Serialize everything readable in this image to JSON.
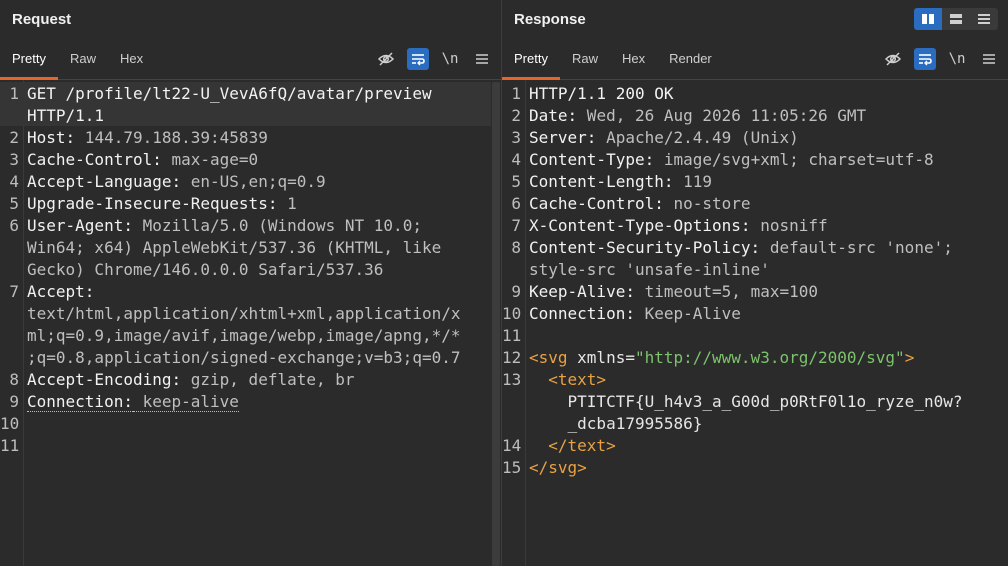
{
  "request": {
    "title": "Request",
    "tabs": [
      "Pretty",
      "Raw",
      "Hex"
    ],
    "active_tab": "Pretty",
    "lines": [
      {
        "n": "1",
        "key": "GET /profile/lt22-U_VevA6fQ/avatar/preview",
        "val": ""
      },
      {
        "n": "",
        "key": "HTTP/1.1",
        "val": ""
      },
      {
        "n": "2",
        "key": "Host:",
        "val": " 144.79.188.39:45839"
      },
      {
        "n": "3",
        "key": "Cache-Control:",
        "val": " max-age=0"
      },
      {
        "n": "4",
        "key": "Accept-Language:",
        "val": " en-US,en;q=0.9"
      },
      {
        "n": "5",
        "key": "Upgrade-Insecure-Requests:",
        "val": " 1"
      },
      {
        "n": "6",
        "key": "User-Agent:",
        "val": " Mozilla/5.0 (Windows NT 10.0;"
      },
      {
        "n": "",
        "key": "",
        "val": "Win64; x64) AppleWebKit/537.36 (KHTML, like"
      },
      {
        "n": "",
        "key": "",
        "val": "Gecko) Chrome/146.0.0.0 Safari/537.36"
      },
      {
        "n": "7",
        "key": "Accept:",
        "val": ""
      },
      {
        "n": "",
        "key": "",
        "val": "text/html,application/xhtml+xml,application/x"
      },
      {
        "n": "",
        "key": "",
        "val": "ml;q=0.9,image/avif,image/webp,image/apng,*/*"
      },
      {
        "n": "",
        "key": "",
        "val": ";q=0.8,application/signed-exchange;v=b3;q=0.7"
      },
      {
        "n": "8",
        "key": "Accept-Encoding:",
        "val": " gzip, deflate, br"
      },
      {
        "n": "9",
        "key": "Connection:",
        "val": " keep-alive"
      },
      {
        "n": "10",
        "key": "",
        "val": ""
      },
      {
        "n": "11",
        "key": "",
        "val": ""
      }
    ]
  },
  "response": {
    "title": "Response",
    "tabs": [
      "Pretty",
      "Raw",
      "Hex",
      "Render"
    ],
    "active_tab": "Pretty",
    "lines": [
      {
        "n": "1",
        "key": "HTTP/1.1 200 OK",
        "val": ""
      },
      {
        "n": "2",
        "key": "Date:",
        "val": " Wed, 26 Aug 2026 11:05:26 GMT"
      },
      {
        "n": "3",
        "key": "Server:",
        "val": " Apache/2.4.49 (Unix)"
      },
      {
        "n": "4",
        "key": "Content-Type:",
        "val": " image/svg+xml; charset=utf-8"
      },
      {
        "n": "5",
        "key": "Content-Length:",
        "val": " 119"
      },
      {
        "n": "6",
        "key": "Cache-Control:",
        "val": " no-store"
      },
      {
        "n": "7",
        "key": "X-Content-Type-Options:",
        "val": " nosniff"
      },
      {
        "n": "8",
        "key": "Content-Security-Policy:",
        "val": " default-src 'none';"
      },
      {
        "n": "",
        "key": "",
        "val": "style-src 'unsafe-inline'"
      },
      {
        "n": "9",
        "key": "Keep-Alive:",
        "val": " timeout=5, max=100"
      },
      {
        "n": "10",
        "key": "Connection:",
        "val": " Keep-Alive"
      },
      {
        "n": "11",
        "key": "",
        "val": ""
      }
    ],
    "svg_lines": [
      {
        "n": "12",
        "parts": [
          [
            "tagc",
            "<svg"
          ],
          [
            "attr",
            " xmlns="
          ],
          [
            "str",
            "\"http://www.w3.org/2000/svg\""
          ],
          [
            "tagc",
            ">"
          ]
        ]
      },
      {
        "n": "13",
        "parts": [
          [
            "txt",
            "  "
          ],
          [
            "tagc",
            "<text>"
          ]
        ]
      },
      {
        "n": "",
        "parts": [
          [
            "txt",
            "    PTITCTF{U_h4v3_a_G00d_p0RtF0l1o_ryze_n0w?"
          ]
        ]
      },
      {
        "n": "",
        "parts": [
          [
            "txt",
            "    _dcba17995586}"
          ]
        ]
      },
      {
        "n": "14",
        "parts": [
          [
            "txt",
            "  "
          ],
          [
            "tagc",
            "</text>"
          ]
        ]
      },
      {
        "n": "15",
        "parts": [
          [
            "tagc",
            "</svg>"
          ]
        ]
      }
    ]
  },
  "toolbar": {
    "newline_label": "\\n",
    "icons": [
      "hide-icon",
      "wrap-icon",
      "newline-icon",
      "menu-icon"
    ]
  },
  "layout_toggle": [
    "split-horizontal-icon",
    "split-vertical-icon",
    "single-pane-icon"
  ]
}
